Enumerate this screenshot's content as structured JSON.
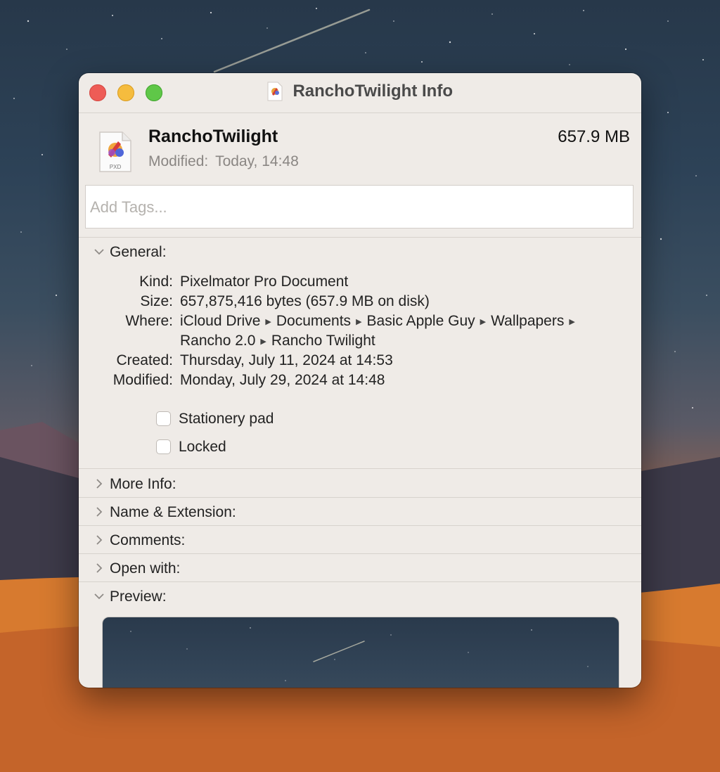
{
  "window": {
    "title": "RanchoTwilight Info"
  },
  "file": {
    "name": "RanchoTwilight",
    "size": "657.9 MB",
    "modified_label": "Modified:",
    "modified_value": "Today, 14:48",
    "icon_ext": "PXD"
  },
  "tags": {
    "placeholder": "Add Tags..."
  },
  "general": {
    "label": "General:",
    "kind_label": "Kind:",
    "kind_value": "Pixelmator Pro Document",
    "size_label": "Size:",
    "size_value": "657,875,416 bytes (657.9 MB on disk)",
    "where_label": "Where:",
    "where_path": [
      "iCloud Drive",
      "Documents",
      "Basic Apple Guy",
      "Wallpapers",
      "Rancho 2.0",
      "Rancho Twilight"
    ],
    "created_label": "Created:",
    "created_value": "Thursday, July 11, 2024 at 14:53",
    "modified_label": "Modified:",
    "modified_value": "Monday, July 29, 2024 at 14:48",
    "stationery_label": "Stationery pad",
    "stationery_checked": false,
    "locked_label": "Locked",
    "locked_checked": false
  },
  "sections": {
    "more_info": "More Info:",
    "name_extension": "Name & Extension:",
    "comments": "Comments:",
    "open_with": "Open with:",
    "preview": "Preview:"
  },
  "icons": {
    "close": "close-button",
    "minimize": "minimize-button",
    "zoom": "zoom-button",
    "disclosure_open": "chevron-down-icon",
    "disclosure_closed": "chevron-right-icon",
    "document": "pixelmator-document-icon"
  },
  "colors": {
    "close": "#ee5c56",
    "minimize": "#f5bc3e",
    "zoom": "#5fc748",
    "window_bg": "#efebe7"
  }
}
